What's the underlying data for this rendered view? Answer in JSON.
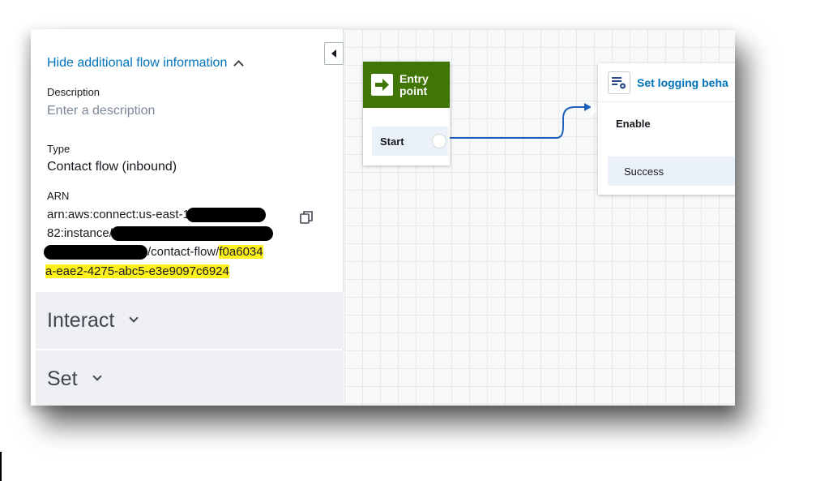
{
  "panel": {
    "hide_link": "Hide additional flow information",
    "description": {
      "label": "Description",
      "placeholder": "Enter a description"
    },
    "type": {
      "label": "Type",
      "value": "Contact flow (inbound)"
    },
    "arn": {
      "label": "ARN",
      "line1": "arn:aws:connect:us-east-1",
      "line2": "82:instance/",
      "line3_text": "/contact-flow/",
      "line3_highlight": "f0a6034",
      "line4_highlight": "a-eae2-4275-abc5-e3e9097c6924"
    },
    "sections": [
      {
        "label": "Interact"
      },
      {
        "label": "Set"
      }
    ]
  },
  "canvas": {
    "entry_block": {
      "title_line1": "Entry",
      "title_line2": "point",
      "start_label": "Start"
    },
    "logging_block": {
      "title": "Set logging beha",
      "enable_label": "Enable",
      "success_label": "Success"
    }
  },
  "colors": {
    "link": "#0073bb",
    "entry_header": "#417505",
    "highlight": "#fff21a",
    "connector": "#1f5fb8"
  }
}
